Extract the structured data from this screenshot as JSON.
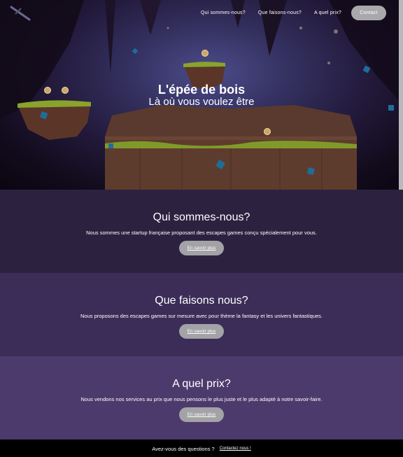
{
  "nav": {
    "items": [
      {
        "label": "Qui sommes-nous?"
      },
      {
        "label": "Que faisons-nous?"
      },
      {
        "label": "A quel prix?"
      }
    ],
    "contact_label": "Contact"
  },
  "hero": {
    "title": "L'épée de bois",
    "subtitle": "Là où vous voulez être"
  },
  "sections": [
    {
      "title": "Qui sommes-nous?",
      "text": "Nous sommes une startup française proposant des escapes games conçu spécialement pour vous.",
      "button_label": "En savoir plus",
      "color": "#2c2240"
    },
    {
      "title": "Que faisons nous?",
      "text": "Nous proposons des escapes games sur mesure avec pour thème la fantasy et les univers fantastiques.",
      "button_label": "En savoir plus",
      "color": "#3b2d57"
    },
    {
      "title": "A quel prix?",
      "text": "Nous vendons nos services au prix que nous pensons le plus juste et le plus adapté à notre savoir-faire.",
      "button_label": "En savoir plus",
      "color": "#4d3a6c"
    }
  ],
  "footer": {
    "question": "Avez-vous des questions ?",
    "link_label": "Contactez nous !"
  },
  "icons": {
    "logo": "sword-icon"
  }
}
